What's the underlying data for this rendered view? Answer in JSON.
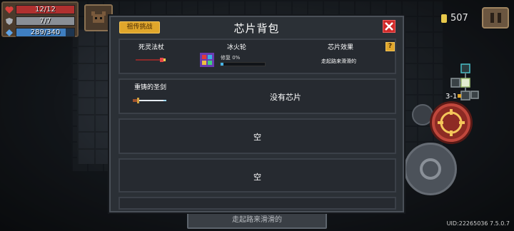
{
  "hud": {
    "hp": "12/12",
    "hp_fraction": 1.0,
    "armor": "7/7",
    "armor_fraction": 1.0,
    "energy": "289/340",
    "energy_fraction": 0.85,
    "coins": "507",
    "level": "3-1",
    "uid": "UID:22265036 7.5.0.7",
    "bottom_hint": "走起路来滑滑的"
  },
  "modal": {
    "title": "芯片背包",
    "legend_button": "祖传挑战",
    "help_label": "?",
    "slot1": {
      "weapon": "死灵法杖",
      "chip": "冰火轮",
      "repair_label": "修复 0%",
      "repair_fraction": 0.06,
      "effect_header": "芯片效果",
      "effect": "走起路来滑滑的"
    },
    "slot2": {
      "weapon": "重铸的圣剑",
      "status": "没有芯片"
    },
    "slot3": {
      "status": "空"
    },
    "slot4": {
      "status": "空"
    }
  },
  "colors": {
    "hp": "#b0302f",
    "armor": "#8a8f96",
    "energy": "#3f7fc2",
    "accent": "#e0a62b",
    "close": "#d12a2a",
    "repair": "#46b4e6"
  }
}
